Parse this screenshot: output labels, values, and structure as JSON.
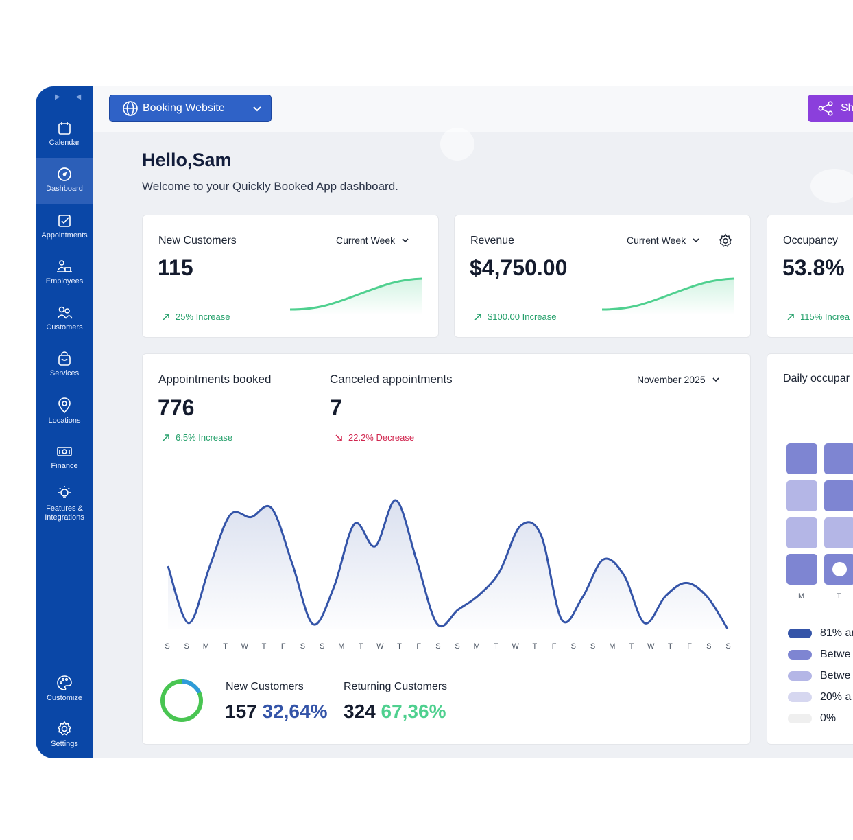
{
  "sidebar": {
    "items": [
      {
        "label": "Calendar"
      },
      {
        "label": "Dashboard"
      },
      {
        "label": "Appointments"
      },
      {
        "label": "Employees"
      },
      {
        "label": "Customers"
      },
      {
        "label": "Services"
      },
      {
        "label": "Locations"
      },
      {
        "label": "Finance"
      },
      {
        "label": "Features &"
      },
      {
        "label": "Integrations"
      },
      {
        "label": "Customize"
      },
      {
        "label": "Settings"
      }
    ],
    "active": "Dashboard"
  },
  "topbar": {
    "booking_label": "Booking Website",
    "share_label": "Sh"
  },
  "greeting": {
    "title": "Hello,Sam",
    "subtitle": "Welcome to your Quickly Booked App dashboard."
  },
  "cards": {
    "new_customers": {
      "title": "New Customers",
      "period": "Current Week",
      "value": "115",
      "delta": "25% Increase"
    },
    "revenue": {
      "title": "Revenue",
      "period": "Current Week",
      "value": "$4,750.00",
      "delta": "$100.00 Increase"
    },
    "occupancy": {
      "title": "Occupancy",
      "value": "53.8%",
      "delta": "115% Increa"
    }
  },
  "appointments": {
    "booked_title": "Appointments booked",
    "booked_value": "776",
    "booked_delta": "6.5% Increase",
    "canceled_title": "Canceled appointments",
    "canceled_value": "7",
    "canceled_delta": "22.2% Decrease",
    "period": "November 2025",
    "new_customers_label": "New Customers",
    "new_customers_count": "157",
    "new_customers_pct": "32,64%",
    "returning_label": "Returning Customers",
    "returning_count": "324",
    "returning_pct": "67,36%"
  },
  "daily_occupancy": {
    "title": "Daily occupar",
    "day_labels": [
      "M",
      "T"
    ],
    "legend": [
      "81% ar",
      "Betwe",
      "Betwe",
      "20% a",
      "0%"
    ]
  },
  "colors": {
    "sidebar": "#0a47a7",
    "accent_blue": "#2f62c7",
    "share_purple": "#8b3fdc",
    "increase_green": "#25a06b",
    "decrease_red": "#d1264f",
    "chart_line": "#3454a8",
    "spark_green": "#4fd08f"
  },
  "chart_data": {
    "type": "area",
    "title": "",
    "x": [
      "S",
      "S",
      "M",
      "T",
      "W",
      "T",
      "F",
      "S",
      "S",
      "M",
      "T",
      "W",
      "T",
      "F",
      "S",
      "S",
      "M",
      "T",
      "W",
      "T",
      "F",
      "S",
      "S",
      "M",
      "T",
      "W",
      "T",
      "F",
      "S",
      "S"
    ],
    "series": [
      {
        "values": [
          56,
          5,
          55,
          102,
          100,
          108,
          58,
          4,
          37,
          94,
          74,
          115,
          61,
          4,
          17,
          30,
          51,
          92,
          84,
          8,
          28,
          62,
          48,
          5,
          29,
          41,
          29,
          0
        ]
      }
    ],
    "ylim": [
      0,
      120
    ],
    "grid": false,
    "legend": "none"
  }
}
